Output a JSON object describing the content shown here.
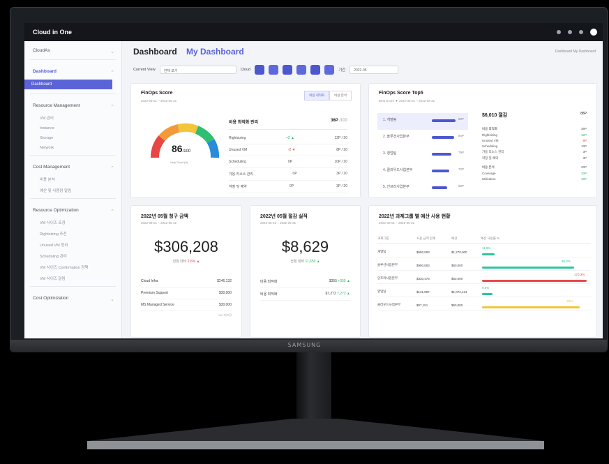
{
  "app": {
    "title": "Cloud in One"
  },
  "device": {
    "brand": "SAMSUNG"
  },
  "sidebar": {
    "groups": [
      {
        "label": "CloudAs"
      },
      {
        "label": "Dashboard",
        "active": true,
        "sub_active": "Dashboard"
      },
      {
        "label": "Resource Management",
        "items": [
          "VM 관리",
          "Instance",
          "Storage",
          "Network"
        ]
      },
      {
        "label": "Cost Management",
        "items": [
          "비용 분석",
          "예산 및 사용량 알림"
        ]
      },
      {
        "label": "Resource Optimization",
        "items": [
          "VM 사이즈 조정",
          "Rightsizing 추천",
          "Unused VM 정리",
          "Scheduling 관리",
          "VM 사이즈 Confirmation 정책",
          "VM 사이즈 알림"
        ]
      },
      {
        "label": "Cost Optimization"
      }
    ]
  },
  "header": {
    "title": "Dashboard",
    "subtitle": "My Dashboard",
    "breadcrumb": "Dashboard  My Dashboard",
    "current_view_label": "Current View",
    "current_view_value": "전체 보기",
    "cloud_label": "Cloud",
    "period_label": "기간",
    "period_value": "2022-05"
  },
  "finops_score": {
    "title": "FinOps Score",
    "date": "2022-05-01 ~ 2022-05-31",
    "tabs": [
      "비용 최적화",
      "비용 분석"
    ],
    "gauge_value": "86",
    "gauge_unit": "/100",
    "gauge_caption": "Very Good (A)",
    "table_title": "비용 최적화 관리",
    "table_value": "36P",
    "table_total": "/100",
    "rows": [
      {
        "name": "Rightsizing",
        "change": "+2 ▲",
        "score": "12P / 20"
      },
      {
        "name": "Unused VM",
        "change": "-2 ▼",
        "score": "8P / 20"
      },
      {
        "name": "Scheduling",
        "change": "0P",
        "score": "10P / 20"
      },
      {
        "name": "가용 리소스 관리",
        "change": "0P",
        "score": "3P / 20"
      },
      {
        "name": "약정 및 예약",
        "change": "0P",
        "score": "3P / 20"
      }
    ]
  },
  "top5": {
    "title": "FinOps Score Top5",
    "date": "Best Score ▼   2022-05-01 ~ 2022-05-31",
    "items": [
      {
        "name": "1. 개발팀",
        "score": "88P",
        "bar": 0.86
      },
      {
        "name": "2. 솔루션사업본부",
        "score": "84P",
        "bar": 0.8
      },
      {
        "name": "3. 영업팀",
        "score": "79P",
        "bar": 0.7
      },
      {
        "name": "4. 클라우드사업본부",
        "score": "72P",
        "bar": 0.62
      },
      {
        "name": "5. 인프라사업본부",
        "score": "68P",
        "bar": 0.56
      }
    ],
    "detail": {
      "title": "$6,010 절감",
      "score": "88P",
      "sections": [
        {
          "name": "비용 최적화",
          "score": "36P",
          "rows": [
            {
              "name": "Rightsizing",
              "score": "12P"
            },
            {
              "name": "Unused VM",
              "score": "8P"
            },
            {
              "name": "Scheduling",
              "score": "10P"
            },
            {
              "name": "가용 리소스 관리",
              "score": "3P"
            },
            {
              "name": "약정 및 예약",
              "score": "3P"
            }
          ]
        },
        {
          "name": "비용 분석",
          "score": "20P",
          "rows": [
            {
              "name": "Coverage",
              "score": "10P"
            },
            {
              "name": "Utilization",
              "score": "10P"
            }
          ]
        }
      ]
    }
  },
  "monthly_bill": {
    "title": "2022년 05월 청구 금액",
    "date": "2022-05-01 ~ 2022-05-31",
    "amount": "$306,208",
    "delta_label": "전월 대비",
    "delta": "2.6% ▲",
    "rows": [
      {
        "name": "Cloud Infra",
        "value": "$246,132"
      },
      {
        "name": "Premium Support",
        "value": "$30,000"
      },
      {
        "name": "MS Managed Service",
        "value": "$30,000"
      }
    ],
    "note": "VAT 미포함"
  },
  "monthly_savings": {
    "title": "2022년 05월 절감 실적",
    "date": "2022-05-01 ~ 2022-05-31",
    "amount": "$8,629",
    "delta_label": "전월 대비",
    "delta": "11,659 ▲",
    "rows": [
      {
        "name": "비용 최적화",
        "value": "$355",
        "change": "+355 ▲"
      },
      {
        "name": "비용 최적화",
        "value": "$7,272",
        "change": "7,272 ▲"
      }
    ]
  },
  "budget": {
    "title": "2022년 과제그룹 별 예산 사용 현황",
    "date": "2022-05-01 ~ 2022-05-31",
    "columns": [
      "과제그룹",
      "사용 금액 합계",
      "예산",
      "예산 사용률 %"
    ],
    "rows": [
      {
        "group": "개발팀",
        "used": "$680,083",
        "budget": "$1,270,000",
        "pct": "11.9%",
        "ratio": 0.12,
        "color": "#2ec4a0"
      },
      {
        "group": "솔루션사업본부",
        "used": "$990,063",
        "budget": "$50,000",
        "pct": "88.3%",
        "ratio": 0.88,
        "color": "#2ec4a0"
      },
      {
        "group": "인프라사업본부",
        "used": "$330,475",
        "budget": "$50,000",
        "pct": "170.3%",
        "ratio": 1.0,
        "color": "#e84a4a"
      },
      {
        "group": "영업팀",
        "used": "$131,897",
        "budget": "$1,072,124",
        "pct": "9.5%",
        "ratio": 0.1,
        "color": "#2ec4a0"
      },
      {
        "group": "클라우드사업본부",
        "used": "$97,151",
        "budget": "$50,000",
        "pct": "93%",
        "ratio": 0.93,
        "color": "#f2c53a"
      }
    ]
  }
}
